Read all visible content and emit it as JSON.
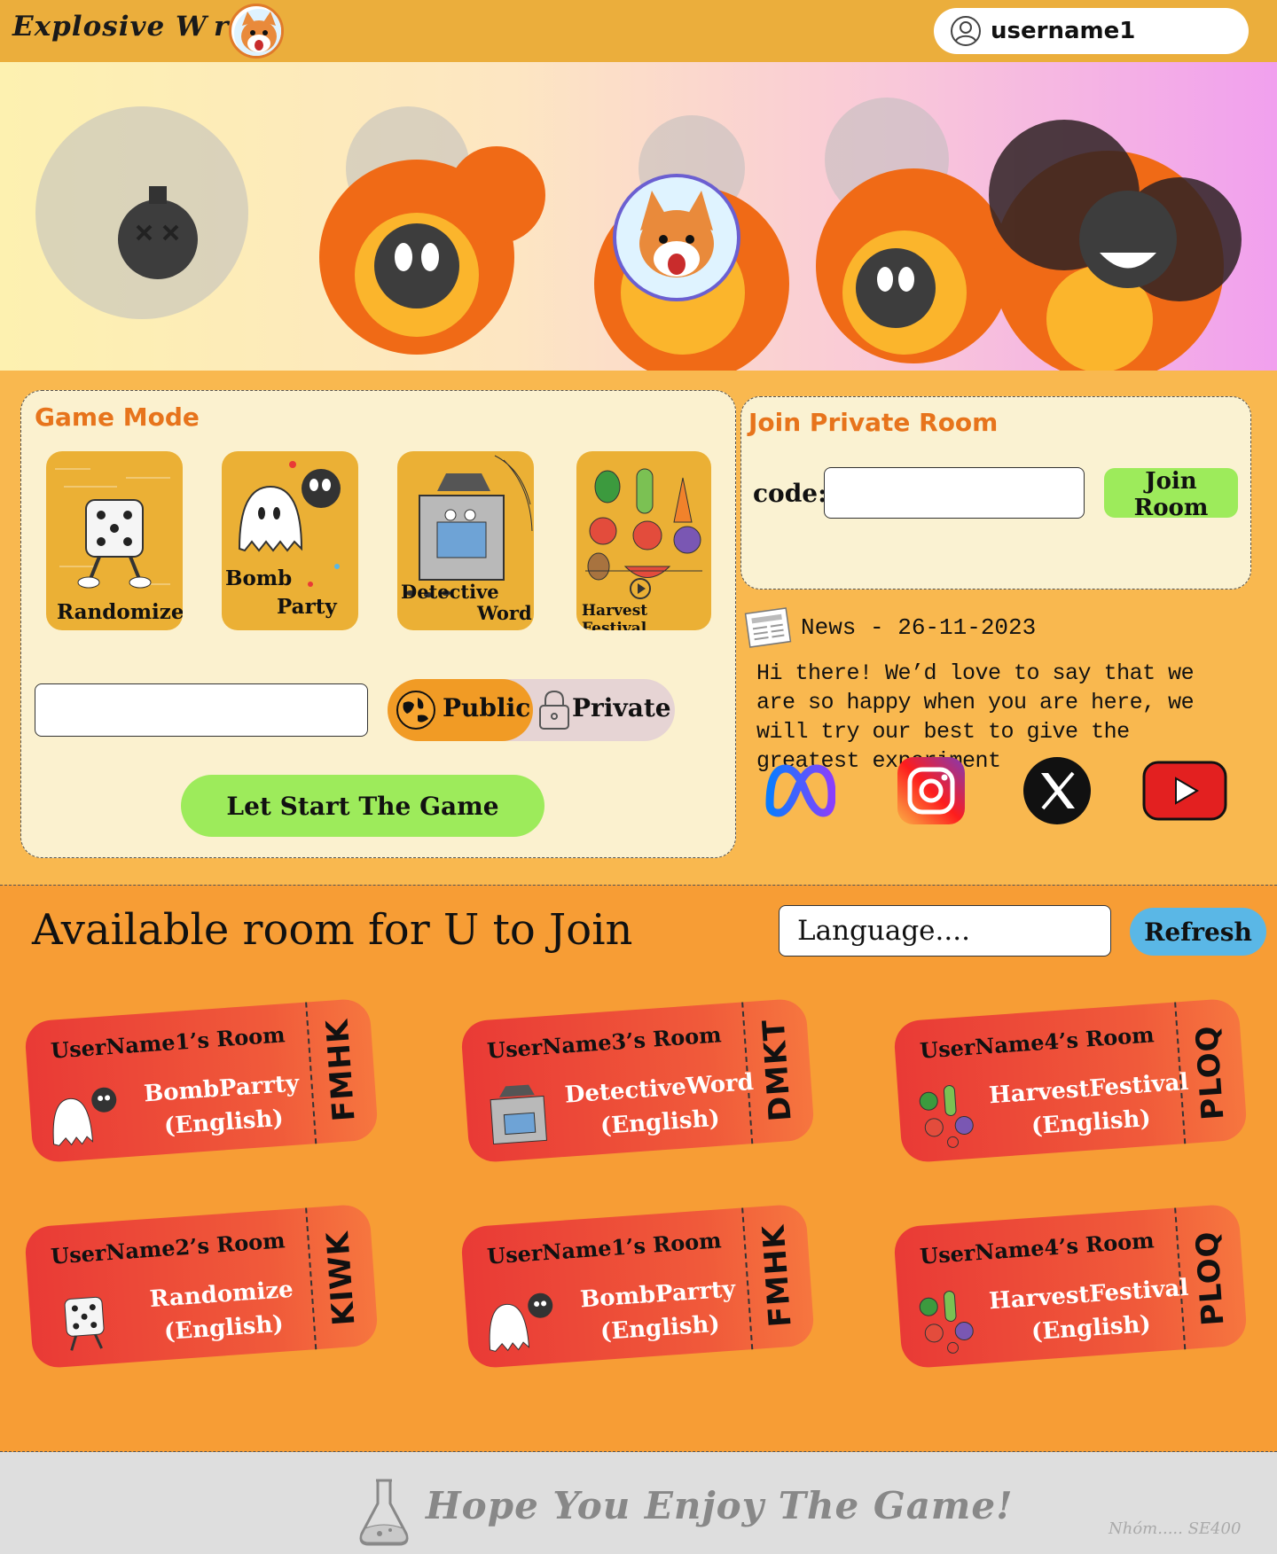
{
  "header": {
    "logo_text": "Explosive W rd",
    "username": "username1"
  },
  "game_mode": {
    "title": "Game Mode",
    "modes": [
      {
        "label_line1": "Randomize",
        "label_line2": ""
      },
      {
        "label_line1": "Bomb",
        "label_line2": "Party"
      },
      {
        "label_line1": "Detective",
        "label_line2": "Word"
      },
      {
        "label_line1": "Harvest Festival",
        "label_line2": ""
      }
    ],
    "room_name_value": "",
    "public_label": "Public",
    "private_label": "Private",
    "start_label": "Let Start The Game"
  },
  "join_room": {
    "title": "Join Private Room",
    "code_label": "code:",
    "code_value": "",
    "join_label": "Join Room"
  },
  "news": {
    "heading": "News - 26-11-2023",
    "body": "Hi there! We’d love to say that we are so happy when you are here, we will try our best to give the greatest experiment",
    "socials": [
      "meta-icon",
      "instagram-icon",
      "x-icon",
      "youtube-icon"
    ]
  },
  "rooms": {
    "title": "Available room for U to Join",
    "language_placeholder": "Language....",
    "refresh_label": "Refresh",
    "list": [
      {
        "owner": "UserName1’s Room",
        "mode": "BombParrty",
        "language": "(English)",
        "code": "FMHK"
      },
      {
        "owner": "UserName3’s Room",
        "mode": "DetectiveWord",
        "language": "(English)",
        "code": "DMKT"
      },
      {
        "owner": "UserName4’s Room",
        "mode": "HarvestFestival",
        "language": "(English)",
        "code": "PLOQ"
      },
      {
        "owner": "UserName2’s Room",
        "mode": "Randomize",
        "language": "(English)",
        "code": "KIWK"
      },
      {
        "owner": "UserName1’s Room",
        "mode": "BombParrty",
        "language": "(English)",
        "code": "FMHK"
      },
      {
        "owner": "UserName4’s Room",
        "mode": "HarvestFestival",
        "language": "(English)",
        "code": "PLOQ"
      }
    ]
  },
  "footer": {
    "tagline": "Hope You Enjoy The Game!",
    "credit": "Nhóm..... SE400"
  },
  "colors": {
    "header_bg": "#ebae3c",
    "accent_orange": "#e7741c",
    "button_green": "#9deb5b",
    "refresh_blue": "#5ab7e6",
    "ticket_red": "#e93a36"
  }
}
